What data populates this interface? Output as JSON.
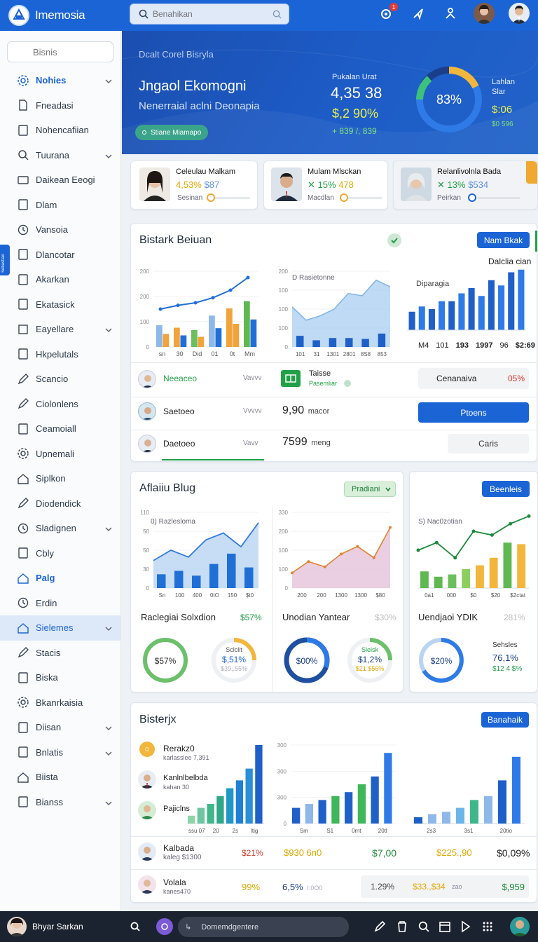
{
  "app": {
    "title": "Imemosia"
  },
  "search": {
    "placeholder": "Benahikan"
  },
  "top_icons": {
    "badge": "1"
  },
  "sidebar": {
    "search_placeholder": "Bisnis",
    "items": [
      {
        "label": "Nohies"
      },
      {
        "label": "Fneadasi"
      },
      {
        "label": "Nohencafiian"
      },
      {
        "label": "Tuurana"
      },
      {
        "label": "Daikean Eeogi"
      },
      {
        "label": "Dlam"
      },
      {
        "label": "Vansoia"
      },
      {
        "label": "Dlancotar"
      },
      {
        "label": "Akarkan"
      },
      {
        "label": "Ekatasick"
      },
      {
        "label": "Eayellare"
      },
      {
        "label": "Hkpelutals"
      },
      {
        "label": "Scancio"
      },
      {
        "label": "Ciolonlens"
      },
      {
        "label": "Ceamoiall"
      },
      {
        "label": "Upnemali"
      },
      {
        "label": "Siplkon"
      },
      {
        "label": "Diodendick"
      },
      {
        "label": "Sladignen"
      },
      {
        "label": "Cbly"
      },
      {
        "label": "Palg"
      },
      {
        "label": "Erdin"
      },
      {
        "label": "Sielemes"
      },
      {
        "label": "Stacis"
      },
      {
        "label": "Biska"
      },
      {
        "label": "Bkanrkaisia"
      },
      {
        "label": "Diisan"
      },
      {
        "label": "Bnlatis"
      },
      {
        "label": "Biista"
      },
      {
        "label": "Bianss"
      }
    ],
    "tab_label": "Sebastian"
  },
  "hero": {
    "breadcrumb": "Dcalt Corel Bisryla",
    "title": "Jngaol Ekomogni",
    "subtitle": "Nenerraial aclni Deonapia",
    "chip": "Stiane Miamapo",
    "stat_label": "Pukalan Urat",
    "stat_value": "4,35 38",
    "stat_change": "$,2 90%",
    "stat_sub": "+ 839 /, 839",
    "donut_value": "83%",
    "donut_percent": 0.83,
    "side_label": "Lahlan Slar",
    "side_value": "$:06",
    "side_sub": "$0 596"
  },
  "people": [
    {
      "name": "Celeulau Malkam",
      "stat1": "4,53%",
      "stat2": "$87",
      "sub": "Sesinan"
    },
    {
      "name": "Mulam Mlsckan",
      "stat1": "15%",
      "stat2": "478",
      "sub": "Macdlan"
    },
    {
      "name": "Relanlivolnla Bada",
      "stat1": "13%",
      "stat2": "$534",
      "sub": "Peirkan"
    }
  ],
  "section1": {
    "title": "Bistark Beiuan",
    "button": "Nam Bkak",
    "chart_b_label": "D Rasietonne",
    "chart_c_title": "Dalclia cian",
    "chart_c_label": "Diparagia",
    "chart_c_footer": [
      "M4",
      "101",
      "193",
      "1997",
      "96",
      "$2:69"
    ],
    "rows": [
      {
        "name": "Neeaceo",
        "col": "Vavvv",
        "title": "Taisse",
        "sub": "Pasemliar",
        "status": "Cenanaiva",
        "pct": "05%"
      },
      {
        "name": "Saetoeo",
        "col": "Vvvvv",
        "value": "9,90",
        "unit": "macor",
        "action": "Ptoens"
      },
      {
        "name": "Daetoeo",
        "col": "Vavv",
        "value": "7599",
        "unit": "meng",
        "action": "Caris"
      }
    ]
  },
  "section2": {
    "title": "Aflaiiu Blug",
    "dropdown": "Pradiani",
    "button": "Beenleis",
    "chart_a_label": "0) Razlesloma",
    "chart_c_label": "S) Nac0zotian",
    "sub1": {
      "title": "Raclegiai Solxdion",
      "pct": "$57%",
      "donut1": "$57%",
      "d2_label": "Sclclit",
      "d2_value": "$,51%",
      "d2_sub": "$39,.55%"
    },
    "sub2": {
      "title": "Unodian Yantear",
      "pct": "$30%",
      "donut1": "$00%",
      "d2_label": "Sleisk",
      "d2_value": "$1,2%",
      "d2_sub": "$21 $56%"
    },
    "sub3": {
      "title": "Uendjaoi YDIK",
      "pct": "281%",
      "donut1": "$20%",
      "d2_label": "Sehsles",
      "d2_value": "76,1%",
      "d2_sub": "$12 4 $%"
    }
  },
  "section3": {
    "title": "Bisterjx",
    "button": "Banahaik",
    "list": [
      {
        "name": "Rerakz0",
        "sub": "karlasslee 7,391"
      },
      {
        "name": "Kanlnlbelbda",
        "sub": "kahan 30"
      },
      {
        "name": "Pajiclns",
        "sub": ""
      }
    ],
    "rows": [
      {
        "name": "Kalbada",
        "sub": "kaleg $1300",
        "c1": "$21%",
        "c2": "$930 6n0",
        "c3": "$7,00",
        "c4": "$225.,90",
        "c5": "$0,09%"
      },
      {
        "name": "Volala",
        "sub": "kanes470",
        "c1": "99%",
        "c2": "6,5%",
        "c2b": "I:0O0",
        "c3": "1.29%",
        "c4": "$33.,$34",
        "c4b": "zao",
        "c5": "$,959"
      }
    ]
  },
  "chart_data": [
    {
      "type": "bar",
      "categories": [
        "sn",
        "30",
        "Did",
        "01",
        "0t",
        "Mm"
      ],
      "values": [
        45,
        40,
        35,
        65,
        80,
        95
      ],
      "line": [
        60,
        66,
        70,
        78,
        90,
        110
      ],
      "ylim": [
        0,
        200
      ],
      "ticks": [
        "0",
        "100",
        "200",
        "200"
      ]
    },
    {
      "type": "area",
      "values": [
        90,
        60,
        70,
        85,
        120,
        115,
        150,
        135
      ],
      "bars": [
        25,
        15,
        20,
        20,
        18,
        30
      ],
      "labels": [
        "101",
        "31",
        "1301",
        "2801",
        "8S8",
        "853"
      ],
      "ticks": [
        "0",
        "100",
        "100",
        "100",
        "200"
      ]
    },
    {
      "type": "bar",
      "values": [
        35,
        45,
        40,
        55,
        55,
        70,
        80,
        65,
        95,
        85,
        110,
        115
      ],
      "labels": [
        "M4",
        "101",
        "193",
        "1997",
        "96",
        "$2:69"
      ]
    },
    {
      "type": "area",
      "values": [
        40,
        55,
        45,
        70,
        80,
        60,
        95
      ],
      "bars": [
        20,
        25,
        18,
        35,
        50,
        30
      ],
      "labels": [
        "Sn",
        "100",
        "400",
        "0tO",
        "150",
        "$t0"
      ],
      "ticks": [
        "0",
        "30",
        "50",
        "50",
        "110"
      ]
    },
    {
      "type": "area",
      "values": [
        20,
        35,
        28,
        45,
        55,
        40,
        80
      ],
      "labels": [
        "200",
        "200",
        "1300",
        "1300",
        "$80"
      ],
      "ticks": [
        "0",
        "100",
        "100",
        "200",
        "330"
      ]
    },
    {
      "type": "line+bar",
      "values": [
        50,
        60,
        40,
        75,
        70,
        85,
        95
      ],
      "bars": [
        22,
        15,
        18,
        25,
        30,
        40,
        60,
        58
      ],
      "labels": [
        "0a1",
        "000",
        "$0",
        "$20",
        "$2ctat"
      ]
    },
    {
      "type": "bar",
      "values": [
        10,
        20,
        25,
        35,
        45,
        55,
        70,
        100
      ],
      "labels": [
        "ssu 07",
        "20",
        "2s",
        "ltig"
      ]
    },
    {
      "type": "bar",
      "values": [
        20,
        25,
        30,
        35,
        40,
        50,
        60,
        90
      ],
      "labels": [
        "Sm",
        "S1",
        "0mt",
        "20tl"
      ],
      "ticks": [
        "0",
        "300",
        "300",
        "300"
      ]
    },
    {
      "type": "bar",
      "values": [
        8,
        12,
        15,
        20,
        30,
        35,
        55,
        85
      ],
      "labels": [
        "2s3",
        "3s1",
        "20tio"
      ]
    }
  ]
}
